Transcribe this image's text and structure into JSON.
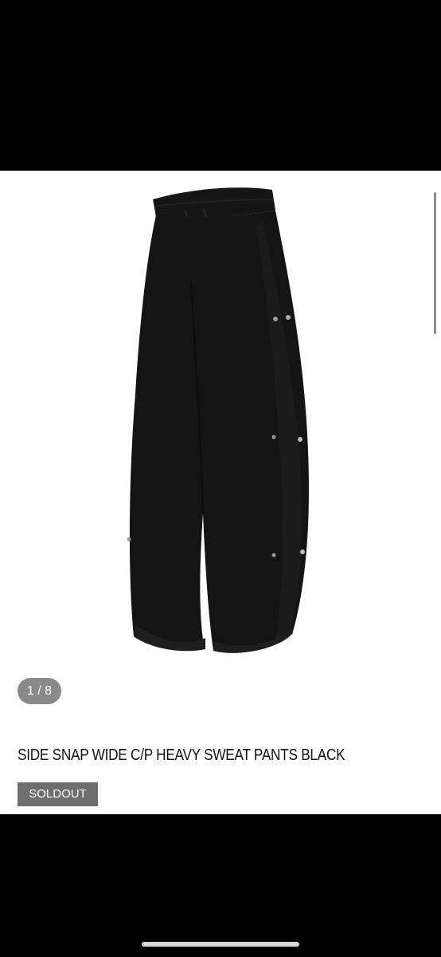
{
  "gallery": {
    "counter": "1 / 8",
    "image": "black-sweat-pants-photo"
  },
  "product": {
    "title": "SIDE SNAP WIDE C/P HEAVY SWEAT PANTS BLACK",
    "status": "SOLDOUT"
  },
  "colors": {
    "page_background": "#ffffff",
    "bars": "#000000",
    "badge": "#6e6e6e",
    "counter_pill": "#8a8a8a"
  }
}
